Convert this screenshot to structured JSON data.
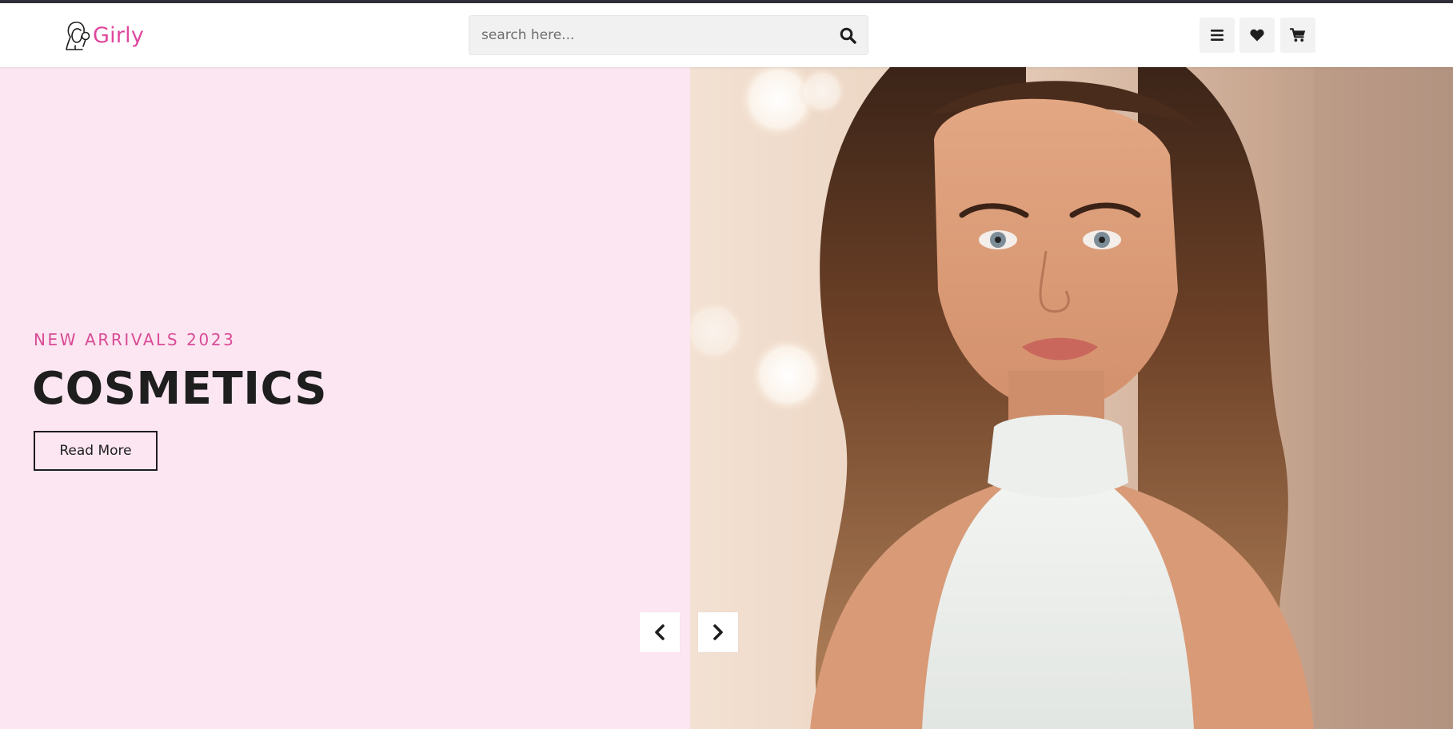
{
  "header": {
    "logo_text": "Girly",
    "logo_icon": "woman-with-mirror-icon",
    "search": {
      "placeholder": "search here...",
      "icon": "search-icon"
    },
    "actions": [
      {
        "icon": "menu-icon"
      },
      {
        "icon": "heart-icon"
      },
      {
        "icon": "cart-icon"
      }
    ]
  },
  "hero": {
    "subtitle": "NEW ARRIVALS 2023",
    "title": "COSMETICS",
    "cta_label": "Read More",
    "image": "portrait-of-woman-with-long-wavy-hair-in-white-halter-top",
    "nav": {
      "prev_icon": "chevron-left-icon",
      "next_icon": "chevron-right-icon"
    }
  },
  "colors": {
    "brand_pink": "#e0479e",
    "hero_background": "#fce6f1",
    "dark_text": "#1e1e1e",
    "top_line": "#2f2f3a"
  }
}
